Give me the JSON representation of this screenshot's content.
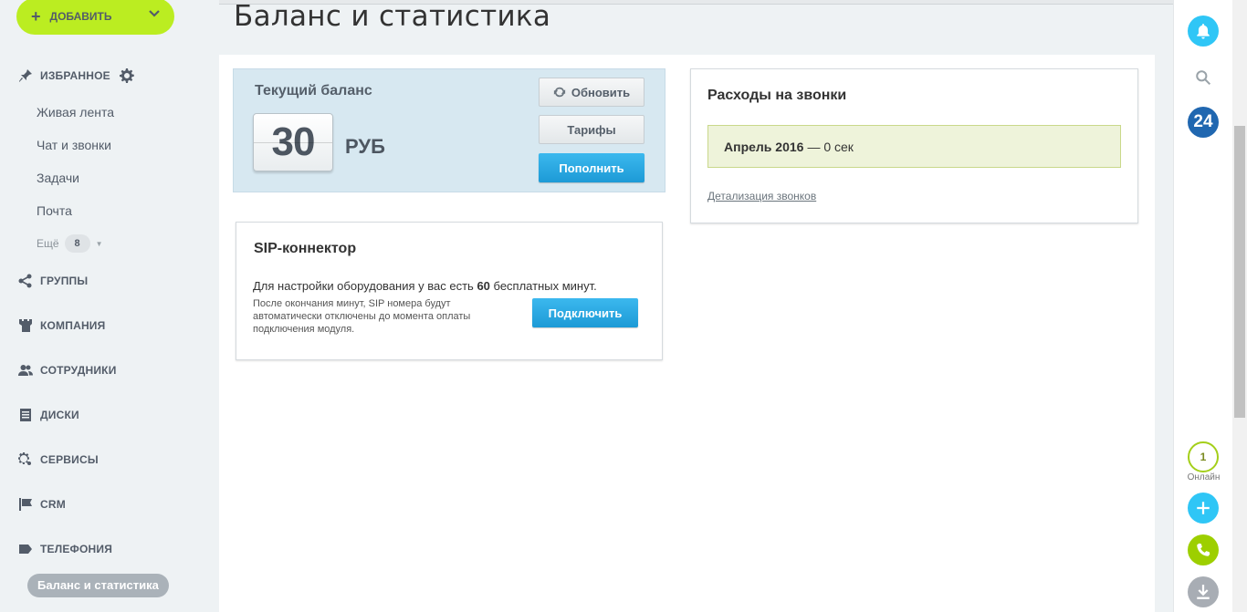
{
  "sidebar": {
    "add_label": "ДОБАВИТЬ",
    "favorites": "ИЗБРАННОЕ",
    "items": [
      "Живая лента",
      "Чат и звонки",
      "Задачи",
      "Почта"
    ],
    "more_label": "Ещё",
    "more_count": "8",
    "sections": [
      "ГРУППЫ",
      "КОМПАНИЯ",
      "СОТРУДНИКИ",
      "ДИСКИ",
      "СЕРВИСЫ",
      "CRM",
      "ТЕЛЕФОНИЯ"
    ],
    "active_item": "Баланс и статистика"
  },
  "page": {
    "title": "Баланс и статистика"
  },
  "balance": {
    "title": "Текущий баланс",
    "amount": "30",
    "currency": "РУБ",
    "refresh_label": "Обновить",
    "tariffs_label": "Тарифы",
    "topup_label": "Пополнить"
  },
  "calls": {
    "title": "Расходы на звонки",
    "month": "Апрель 2016",
    "usage": "— 0 сек",
    "details_link": "Детализация звонков"
  },
  "sip": {
    "title": "SIP-коннектор",
    "text_before": "Для настройки оборудования у вас есть ",
    "minutes": "60",
    "text_after": " бесплатных минут.",
    "note": "После окончания минут, SIP номера будут автоматически отключены до момента оплаты подключения модуля.",
    "connect_label": "Подключить"
  },
  "right_panel": {
    "logo": "24",
    "online_count": "1",
    "online_label": "Онлайн",
    "colors": {
      "bell": "#2fc6f6",
      "logo": "#2067b0",
      "add": "#2fc6f6",
      "phone": "#9dcf00",
      "download": "#a8adb4"
    }
  }
}
